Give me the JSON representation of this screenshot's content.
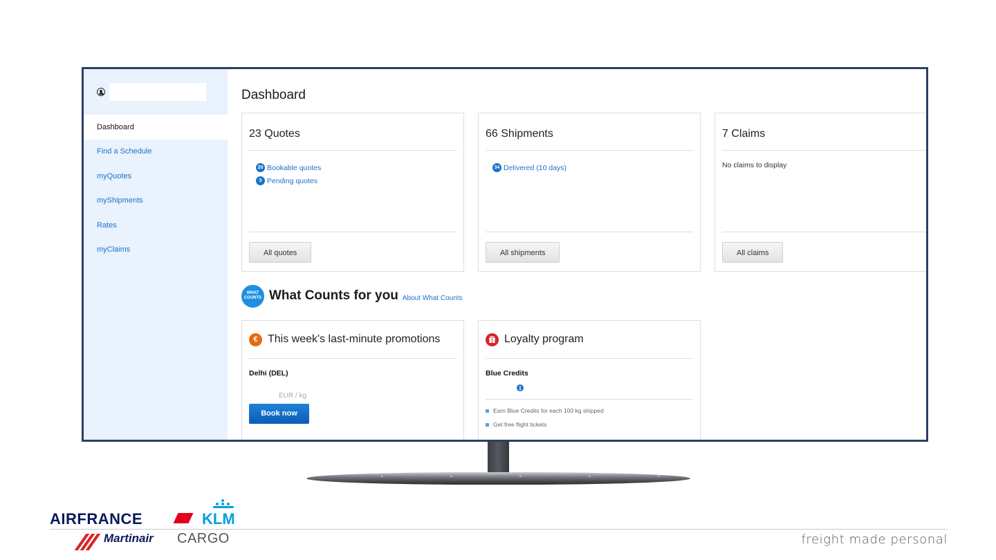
{
  "sidebar": {
    "items": [
      {
        "label": "Dashboard",
        "active": true
      },
      {
        "label": "Find a Schedule",
        "active": false
      },
      {
        "label": "myQuotes",
        "active": false
      },
      {
        "label": "myShipments",
        "active": false
      },
      {
        "label": "Rates",
        "active": false
      },
      {
        "label": "myClaims",
        "active": false
      }
    ]
  },
  "main": {
    "title": "Dashboard",
    "quotes": {
      "title": "23 Quotes",
      "links": [
        {
          "count": "20",
          "label": "Bookable quotes"
        },
        {
          "count": "3",
          "label": "Pending quotes"
        }
      ],
      "button": "All quotes"
    },
    "shipments": {
      "title": "66 Shipments",
      "links": [
        {
          "count": "34",
          "label": "Delivered (10 days)"
        }
      ],
      "button": "All shipments"
    },
    "claims": {
      "title": "7 Claims",
      "empty": "No claims to display",
      "button": "All claims"
    },
    "what_counts": {
      "logo_line1": "WHAT",
      "logo_line2": "COUNTS",
      "title": "What Counts for you",
      "link": "About What Counts"
    },
    "promotions": {
      "icon": "€",
      "title": "This week's last-minute promotions",
      "destination": "Delhi (DEL)",
      "unit": "EUR / kg",
      "button": "Book now"
    },
    "loyalty": {
      "icon": "gift-icon",
      "title": "Loyalty program",
      "subtitle": "Blue Credits",
      "bullets": [
        "Earn Blue Credits for each 100 kg shipped",
        "Get free flight tickets"
      ]
    }
  },
  "branding": {
    "airfrance": "AIRFRANCE",
    "klm": "KLM",
    "martinair": "Martinair",
    "cargo": "CARGO",
    "tagline": "freight made personal",
    "colors": {
      "navy": "#0a1a5c",
      "klm_blue": "#00a1de",
      "red": "#e2001a"
    }
  }
}
